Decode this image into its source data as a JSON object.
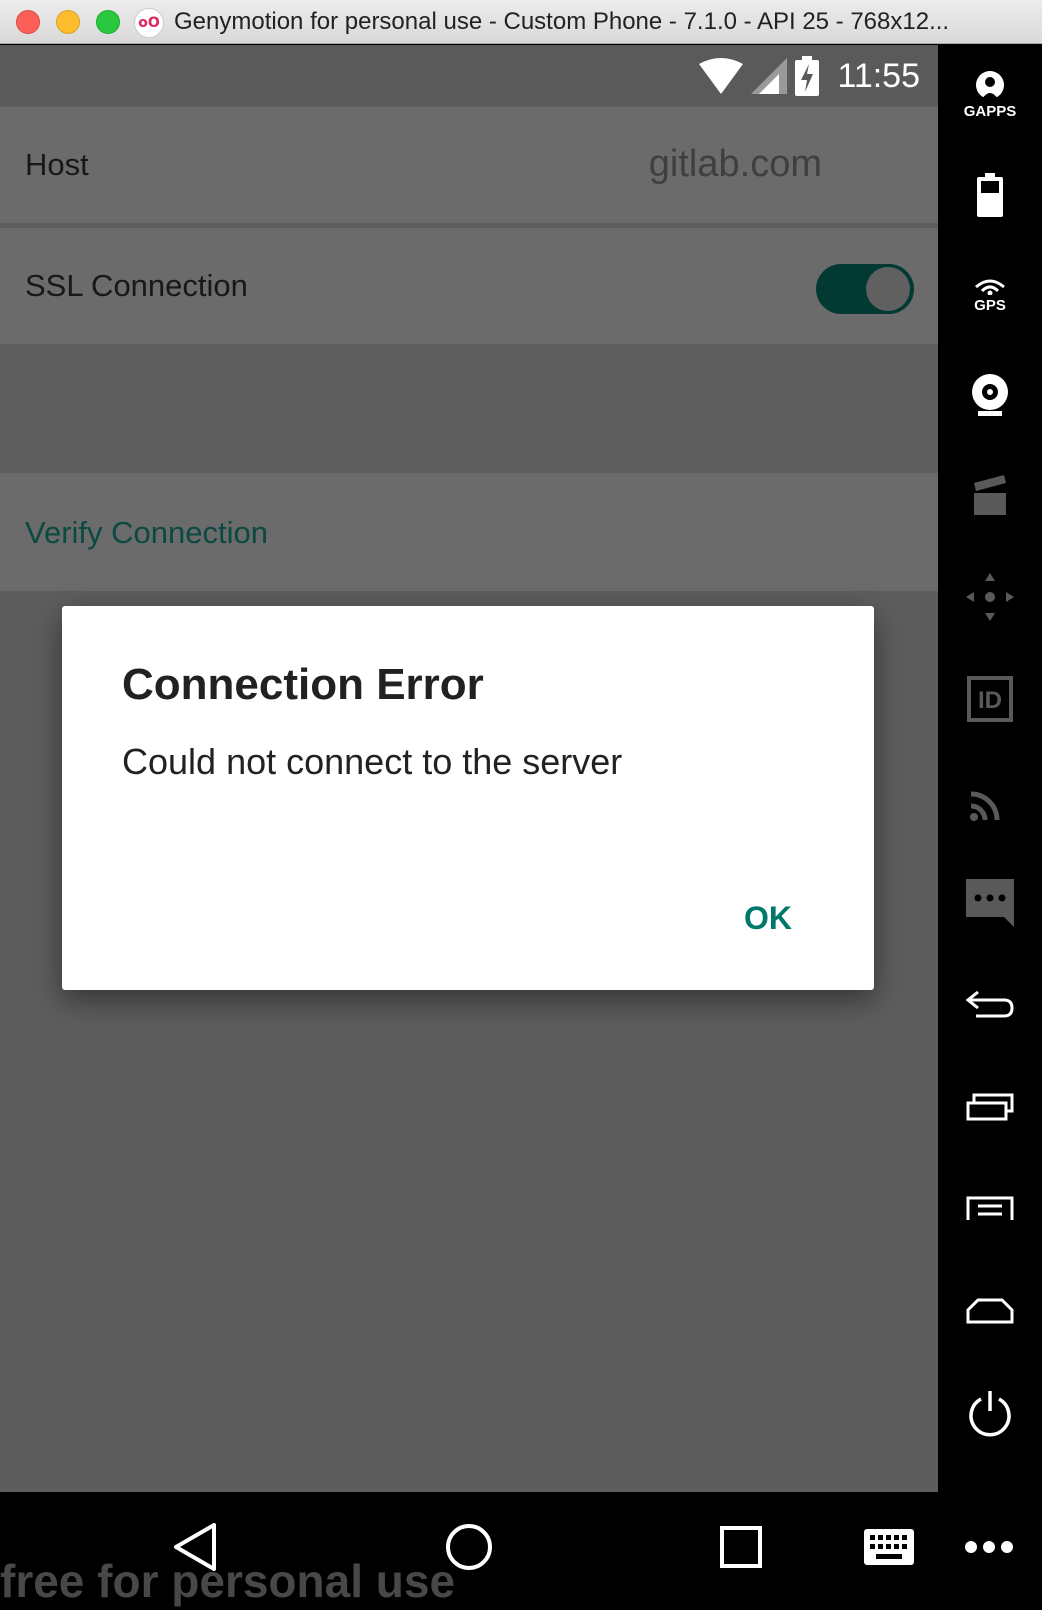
{
  "window": {
    "title": "Genymotion for personal use - Custom Phone - 7.1.0 - API 25 - 768x12...",
    "logo_text": "oO"
  },
  "statusbar": {
    "time": "11:55",
    "icons": [
      "wifi-icon",
      "signal-icon",
      "battery-charging-icon"
    ]
  },
  "settings": {
    "host_label": "Host",
    "host_value": "gitlab.com",
    "ssl_label": "SSL Connection",
    "ssl_enabled": true,
    "verify_label": "Verify Connection"
  },
  "dialog": {
    "title": "Connection Error",
    "message": "Could not connect to the server",
    "ok_label": "OK"
  },
  "tools": {
    "gapps_label": "GAPPS",
    "gps_label": "GPS",
    "id_label": "ID",
    "items": [
      "gapps-icon",
      "battery-icon",
      "gps-icon",
      "camera-icon",
      "media-icon",
      "dpad-icon",
      "id-icon",
      "cast-icon",
      "sms-icon",
      "back-icon",
      "recent-apps-icon",
      "menu-icon",
      "home-icon",
      "power-icon"
    ]
  },
  "navbar": {
    "watermark": "free for personal use",
    "items": [
      "back-nav-icon",
      "home-nav-icon",
      "recents-nav-icon",
      "keyboard-icon",
      "more-icon"
    ]
  },
  "colors": {
    "accent": "#00796b",
    "toggle_track": "#023a33",
    "screen_dim": "#5d5d5d"
  }
}
